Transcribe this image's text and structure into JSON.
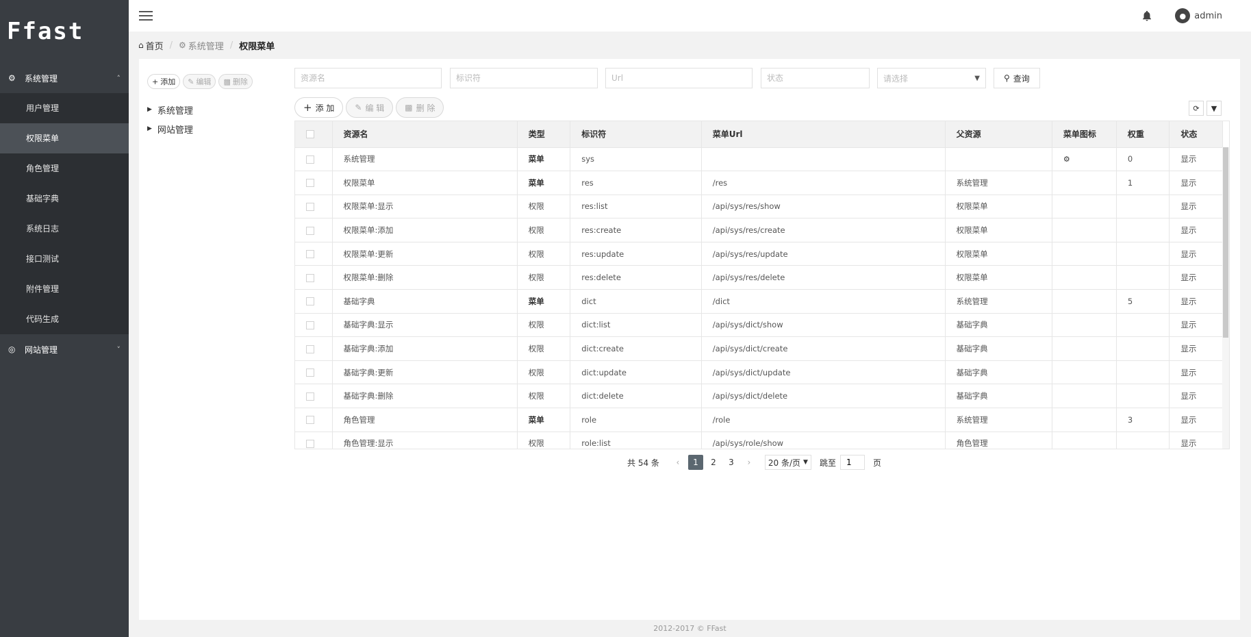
{
  "app": {
    "logo": "Ffast",
    "user": "admin"
  },
  "sidebar": {
    "groups": [
      {
        "label": "系统管理",
        "icon": "gear-icon",
        "expanded": true,
        "items": [
          {
            "label": "用户管理",
            "active": false
          },
          {
            "label": "权限菜单",
            "active": true
          },
          {
            "label": "角色管理",
            "active": false
          },
          {
            "label": "基础字典",
            "active": false
          },
          {
            "label": "系统日志",
            "active": false
          },
          {
            "label": "接口测试",
            "active": false
          },
          {
            "label": "附件管理",
            "active": false
          },
          {
            "label": "代码生成",
            "active": false
          }
        ]
      },
      {
        "label": "网站管理",
        "icon": "globe-icon",
        "expanded": false,
        "items": []
      }
    ]
  },
  "breadcrumb": {
    "home": "首页",
    "parent": "系统管理",
    "current": "权限菜单"
  },
  "tree": {
    "toolbar": {
      "add": "添加",
      "edit": "编辑",
      "delete": "删除"
    },
    "nodes": [
      "系统管理",
      "网站管理"
    ]
  },
  "search": {
    "name_placeholder": "资源名",
    "identifier_placeholder": "标识符",
    "url_placeholder": "Url",
    "status_placeholder": "状态",
    "select_placeholder": "请选择",
    "query": "查询"
  },
  "table_toolbar": {
    "add": "添 加",
    "edit": "编 辑",
    "delete": "删 除"
  },
  "table": {
    "headers": [
      "资源名",
      "类型",
      "标识符",
      "菜单Url",
      "父资源",
      "菜单图标",
      "权重",
      "状态"
    ],
    "rows": [
      [
        "系统管理",
        "菜单",
        "sys",
        "",
        "",
        "gear-icon",
        "0",
        "显示"
      ],
      [
        "权限菜单",
        "菜单",
        "res",
        "/res",
        "系统管理",
        "",
        "1",
        "显示"
      ],
      [
        "权限菜单:显示",
        "权限",
        "res:list",
        "/api/sys/res/show",
        "权限菜单",
        "",
        "",
        "显示"
      ],
      [
        "权限菜单:添加",
        "权限",
        "res:create",
        "/api/sys/res/create",
        "权限菜单",
        "",
        "",
        "显示"
      ],
      [
        "权限菜单:更新",
        "权限",
        "res:update",
        "/api/sys/res/update",
        "权限菜单",
        "",
        "",
        "显示"
      ],
      [
        "权限菜单:删除",
        "权限",
        "res:delete",
        "/api/sys/res/delete",
        "权限菜单",
        "",
        "",
        "显示"
      ],
      [
        "基础字典",
        "菜单",
        "dict",
        "/dict",
        "系统管理",
        "",
        "5",
        "显示"
      ],
      [
        "基础字典:显示",
        "权限",
        "dict:list",
        "/api/sys/dict/show",
        "基础字典",
        "",
        "",
        "显示"
      ],
      [
        "基础字典:添加",
        "权限",
        "dict:create",
        "/api/sys/dict/create",
        "基础字典",
        "",
        "",
        "显示"
      ],
      [
        "基础字典:更新",
        "权限",
        "dict:update",
        "/api/sys/dict/update",
        "基础字典",
        "",
        "",
        "显示"
      ],
      [
        "基础字典:删除",
        "权限",
        "dict:delete",
        "/api/sys/dict/delete",
        "基础字典",
        "",
        "",
        "显示"
      ],
      [
        "角色管理",
        "菜单",
        "role",
        "/role",
        "系统管理",
        "",
        "3",
        "显示"
      ],
      [
        "角色管理:显示",
        "权限",
        "role:list",
        "/api/sys/role/show",
        "角色管理",
        "",
        "",
        "显示"
      ]
    ]
  },
  "pager": {
    "total": "共 54 条",
    "pages": [
      "1",
      "2",
      "3"
    ],
    "current": "1",
    "page_size": "20 条/页",
    "jump_label": "跳至",
    "jump_value": "1",
    "page_suffix": "页"
  },
  "footer": "2012-2017 © FFast"
}
